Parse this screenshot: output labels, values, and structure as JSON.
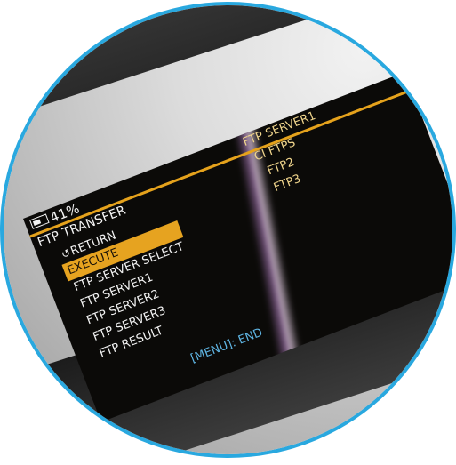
{
  "battery": {
    "label": "41%"
  },
  "menu": {
    "title": "FTP TRANSFER",
    "items": [
      {
        "label": "RETURN",
        "icon": "return-arrow-icon"
      },
      {
        "label": "EXECUTE",
        "selected": true
      },
      {
        "label": "FTP SERVER SELECT"
      },
      {
        "label": "FTP SERVER1"
      },
      {
        "label": "FTP SERVER2"
      },
      {
        "label": "FTP SERVER3"
      },
      {
        "label": "FTP RESULT"
      }
    ]
  },
  "options": [
    "FTP SERVER1",
    "CI FTPS",
    "FTP2",
    "FTP3"
  ],
  "hint": "[MENU]: END",
  "colors": {
    "highlight": "#e6a320",
    "option_text": "#f0d58c",
    "hint_text": "#5fb5e3",
    "ring": "#29a8df"
  }
}
